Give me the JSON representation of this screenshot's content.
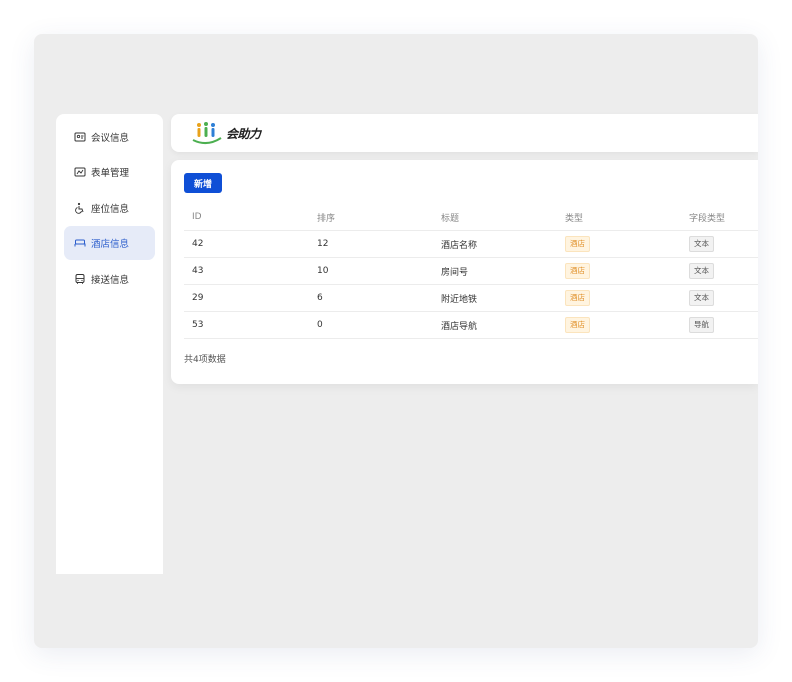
{
  "sidebar": {
    "items": [
      {
        "label": "会议信息",
        "icon": "meeting-info-icon",
        "active": false
      },
      {
        "label": "表单管理",
        "icon": "form-icon",
        "active": false
      },
      {
        "label": "座位信息",
        "icon": "seat-icon",
        "active": false
      },
      {
        "label": "酒店信息",
        "icon": "bed-icon",
        "active": true
      },
      {
        "label": "接送信息",
        "icon": "bus-icon",
        "active": false
      }
    ]
  },
  "header": {
    "logo_text": "会助力"
  },
  "main": {
    "add_button": "新增",
    "table": {
      "headers": [
        "ID",
        "排序",
        "标题",
        "类型",
        "字段类型"
      ],
      "rows": [
        {
          "id": "42",
          "order": "12",
          "title": "酒店名称",
          "type": "酒店",
          "field_type": "文本"
        },
        {
          "id": "43",
          "order": "10",
          "title": "房间号",
          "type": "酒店",
          "field_type": "文本"
        },
        {
          "id": "29",
          "order": "6",
          "title": "附近地铁",
          "type": "酒店",
          "field_type": "文本"
        },
        {
          "id": "53",
          "order": "0",
          "title": "酒店导航",
          "type": "酒店",
          "field_type": "导航"
        }
      ]
    },
    "total_text": "共4项数据"
  },
  "colors": {
    "accent": "#0f4fd6",
    "active_bg": "#e6ebf8",
    "active_text": "#2b5dcc",
    "tag_hotel_bg": "#fff4e0",
    "tag_hotel_text": "#e0902a"
  }
}
